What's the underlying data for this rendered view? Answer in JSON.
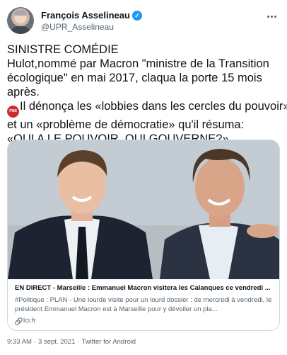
{
  "author": {
    "name": "François Asselineau",
    "handle": "@UPR_Asselineau"
  },
  "icons": {
    "verified": "verified-badge-icon",
    "more": "more-options-icon",
    "emoji": "fns-sign-icon",
    "link": "link-icon"
  },
  "emoji_text": "FNS",
  "tweet": {
    "line1": "SINISTRE COMÉDIE",
    "line2": "Hulot,nommé par Macron \"ministre de la Transition",
    "line3": "écologique\" en mai 2017, claqua la porte 15 mois",
    "line4": "après.",
    "line5": "Il dénonça les «lobbies dans les cercles du pouvoir»",
    "line6": "et un «problème de démocratie» qu'il résuma:",
    "line7": "«QUI A LE POUVOIR, QUI GOUVERNE?»"
  },
  "card": {
    "title": "EN DIRECT - Marseille : Emmanuel Macron visitera les Calanques ce vendredi ...",
    "description": "#Politique : PLAN - Une lourde visite pour un lourd dossier : de mercredi à vendredi, le président Emmanuel Macron est à Marseille pour y dévoiler un pla...",
    "domain": "lci.fr"
  },
  "footer": {
    "time": "9:33 AM",
    "date": "3 sept. 2021",
    "source": "Twitter for Android",
    "separator": "·"
  },
  "colors": {
    "text": "#0f1419",
    "secondary": "#536471",
    "verified": "#1d9bf0",
    "border": "#cfd9de"
  }
}
